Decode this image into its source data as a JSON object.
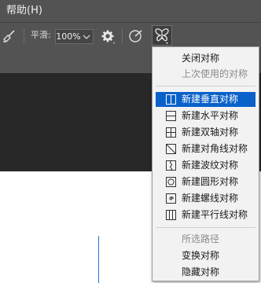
{
  "menubar": {
    "help_label": "帮助(H)"
  },
  "options_bar": {
    "smoothing_label": "平滑:",
    "smoothing_value": "100%"
  },
  "symmetry_menu": {
    "close_symmetry": "关闭对称",
    "last_used": "上次使用的对称",
    "items": [
      {
        "label": "新建垂直对称",
        "icon": "vertical-symmetry-icon",
        "highlighted": true
      },
      {
        "label": "新建水平对称",
        "icon": "horizontal-symmetry-icon"
      },
      {
        "label": "新建双轴对称",
        "icon": "dual-axis-symmetry-icon"
      },
      {
        "label": "新建对角线对称",
        "icon": "diagonal-symmetry-icon"
      },
      {
        "label": "新建波纹对称",
        "icon": "wavy-symmetry-icon"
      },
      {
        "label": "新建圆形对称",
        "icon": "circle-symmetry-icon"
      },
      {
        "label": "新建螺线对称",
        "icon": "spiral-symmetry-icon"
      },
      {
        "label": "新建平行线对称",
        "icon": "parallel-lines-symmetry-icon"
      }
    ],
    "selected_path": "所选路径",
    "transform_symmetry": "变换对称",
    "hide_symmetry": "隐藏对称"
  },
  "colors": {
    "toolbar_bg": "#535353",
    "canvas_dark": "#282828",
    "menu_bg": "#f2f2f2",
    "highlight": "#0a61c9",
    "guide_line": "#2b6fd6"
  }
}
